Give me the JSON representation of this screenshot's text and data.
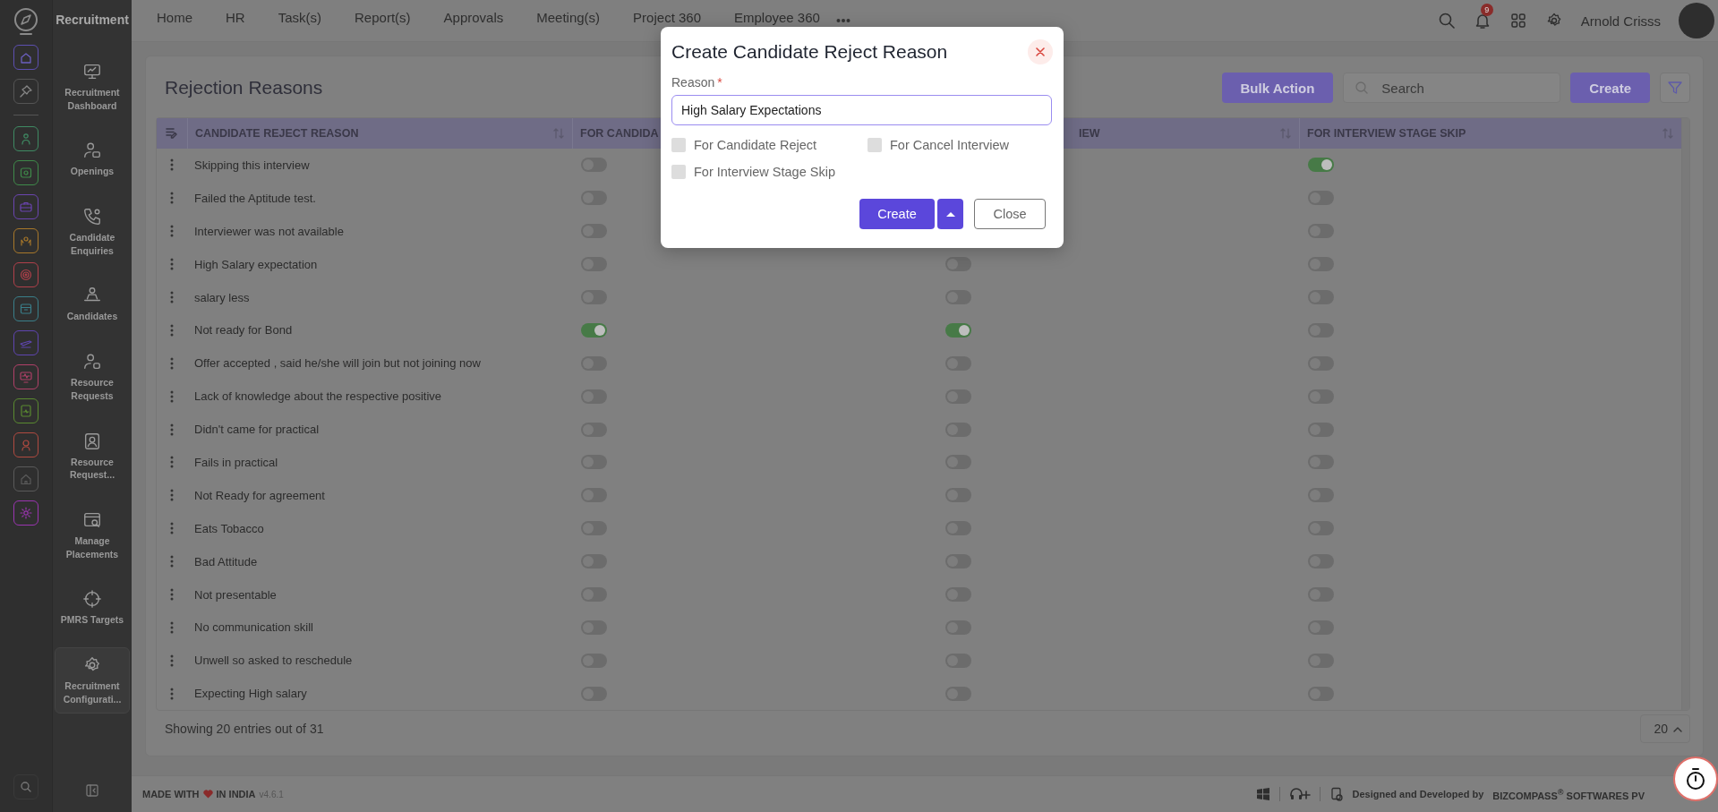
{
  "rail": {
    "top": [
      {
        "selected": true
      },
      {
        "selected": false
      }
    ],
    "modules": [
      {
        "color": "#3f8a63"
      },
      {
        "color": "#3f8a4a"
      },
      {
        "color": "#6b45b0"
      },
      {
        "color": "#a8782a"
      },
      {
        "color": "#b0404a"
      },
      {
        "color": "#3a7f8a"
      },
      {
        "color": "#5f45b0"
      },
      {
        "color": "#b04068"
      },
      {
        "color": "#5a8a30"
      },
      {
        "color": "#b04a40"
      },
      {
        "color": "#5a5a5a"
      },
      {
        "color": "#9a35b0"
      }
    ]
  },
  "sidebar": {
    "title": "Recruitment",
    "items": [
      {
        "label": "Recruitment Dashboard",
        "selected": false
      },
      {
        "label": "Openings",
        "selected": false
      },
      {
        "label": "Candidate Enquiries",
        "selected": false
      },
      {
        "label": "Candidates",
        "selected": false
      },
      {
        "label": "Resource Requests",
        "selected": false
      },
      {
        "label": "Resource Request...",
        "selected": false
      },
      {
        "label": "Manage Placements",
        "selected": false
      },
      {
        "label": "PMRS Targets",
        "selected": false
      },
      {
        "label": "Recruitment Configurati...",
        "selected": true
      }
    ]
  },
  "topnav": {
    "items": [
      "Home",
      "HR",
      "Task(s)",
      "Report(s)",
      "Approvals",
      "Meeting(s)",
      "Project 360",
      "Employee 360"
    ]
  },
  "user": {
    "name": "Arnold Crisss",
    "notifications": "9"
  },
  "page": {
    "title": "Rejection Reasons",
    "bulk_action": "Bulk Action",
    "search": {
      "placeholder": "Search"
    },
    "create": "Create"
  },
  "table": {
    "columns": [
      "CANDIDATE REJECT REASON",
      "FOR CANDIDA",
      "IEW",
      "FOR INTERVIEW STAGE SKIP"
    ],
    "rows": [
      {
        "reason": "Skipping this interview",
        "candidate_reject": false,
        "stage_skip": true
      },
      {
        "reason": "Failed the Aptitude test.",
        "candidate_reject": false,
        "stage_skip": false
      },
      {
        "reason": "Interviewer was not available",
        "candidate_reject": false,
        "stage_skip": false
      },
      {
        "reason": "High Salary expectation",
        "candidate_reject": false,
        "cancel_interview": false,
        "stage_skip": false
      },
      {
        "reason": "salary less",
        "candidate_reject": false,
        "cancel_interview": false,
        "stage_skip": false
      },
      {
        "reason": "Not ready for Bond",
        "candidate_reject": true,
        "cancel_interview": true,
        "stage_skip": false
      },
      {
        "reason": "Offer accepted , said he/she will join but not joining now",
        "candidate_reject": false,
        "cancel_interview": false,
        "stage_skip": false
      },
      {
        "reason": "Lack of knowledge about the respective positive",
        "candidate_reject": false,
        "cancel_interview": false,
        "stage_skip": false
      },
      {
        "reason": "Didn't came for practical",
        "candidate_reject": false,
        "cancel_interview": false,
        "stage_skip": false
      },
      {
        "reason": "Fails in practical",
        "candidate_reject": false,
        "cancel_interview": false,
        "stage_skip": false
      },
      {
        "reason": "Not Ready for agreement",
        "candidate_reject": false,
        "cancel_interview": false,
        "stage_skip": false
      },
      {
        "reason": "Eats Tobacco",
        "candidate_reject": false,
        "cancel_interview": false,
        "stage_skip": false
      },
      {
        "reason": "Bad Attitude",
        "candidate_reject": false,
        "cancel_interview": false,
        "stage_skip": false
      },
      {
        "reason": "Not presentable",
        "candidate_reject": false,
        "cancel_interview": false,
        "stage_skip": false
      },
      {
        "reason": "No communication skill",
        "candidate_reject": false,
        "cancel_interview": false,
        "stage_skip": false
      },
      {
        "reason": "Unwell so asked to reschedule",
        "candidate_reject": false,
        "cancel_interview": false,
        "stage_skip": false
      },
      {
        "reason": "Expecting High salary",
        "candidate_reject": false,
        "cancel_interview": false,
        "stage_skip": false
      }
    ]
  },
  "footer": {
    "showing": "Showing 20 entries out of 31",
    "page_size": "20"
  },
  "bottom_bar": {
    "made_with": "MADE WITH",
    "in_india": "IN INDIA",
    "version": "v4.6.1",
    "designed": "Designed and Developed by",
    "company": "BIZCOMPASS$^{®}$ SOFTWARES PV"
  },
  "modal": {
    "title": "Create Candidate Reject Reason",
    "field": {
      "label": "Reason",
      "required_mark": "*",
      "value": "High Salary Expectations"
    },
    "options": [
      {
        "label": "For Candidate Reject",
        "checked": false
      },
      {
        "label": "For Cancel Interview",
        "checked": false
      },
      {
        "label": "For Interview Stage Skip",
        "checked": false
      }
    ],
    "create": "Create",
    "close": "Close"
  }
}
